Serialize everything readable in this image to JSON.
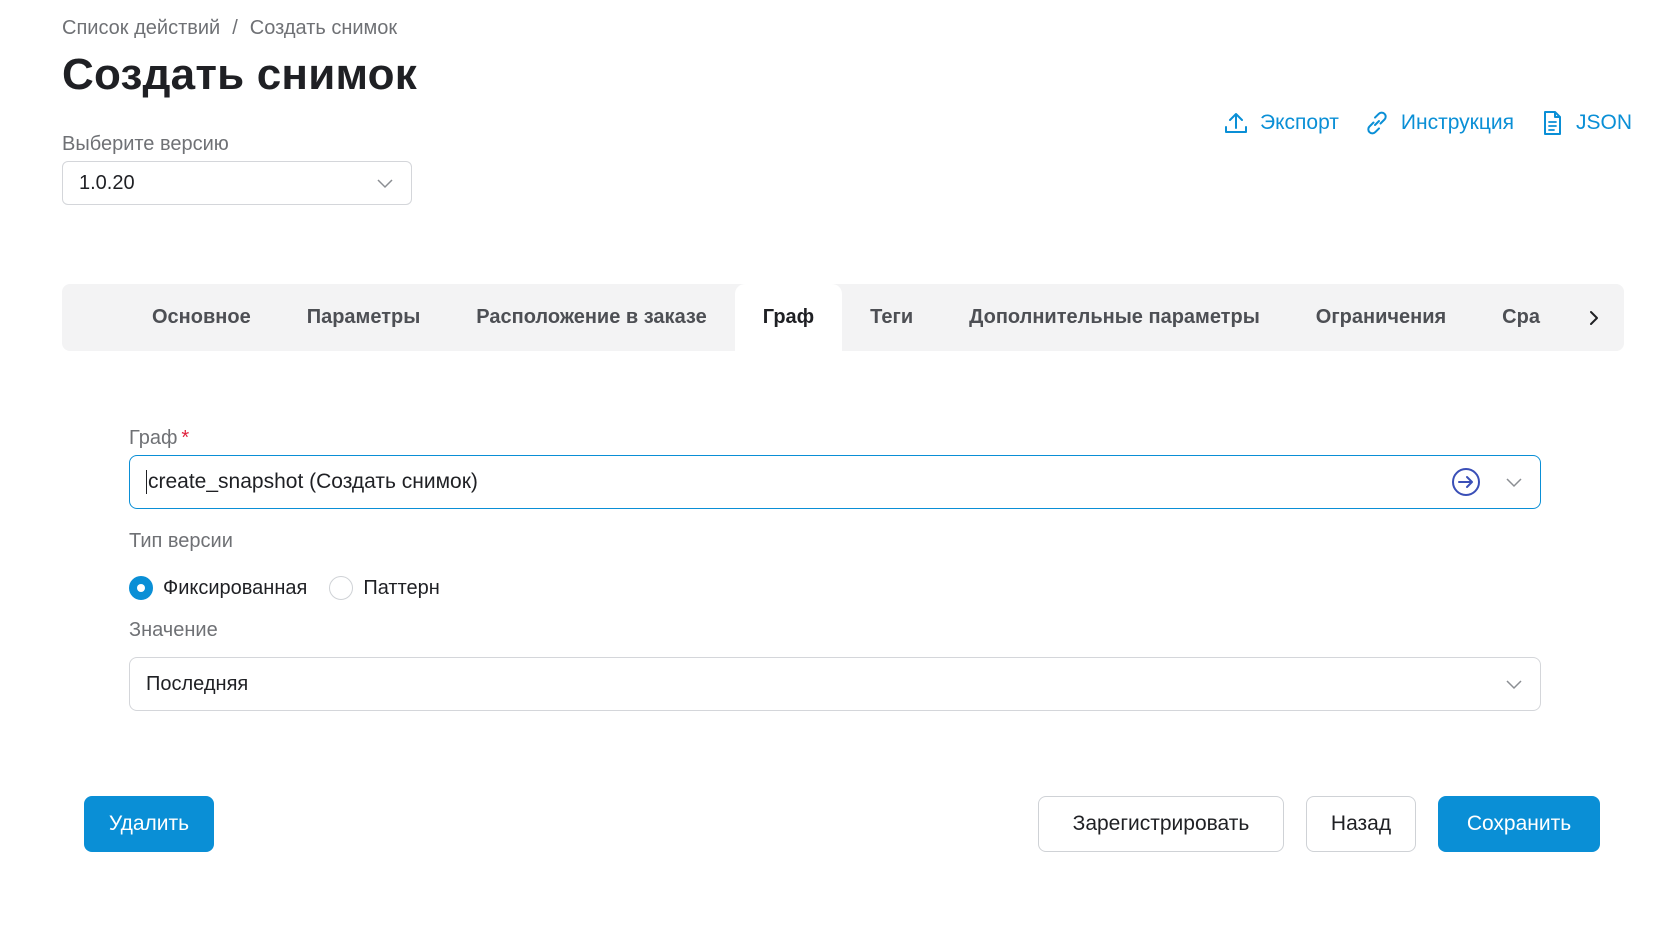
{
  "breadcrumb": {
    "parent": "Список действий",
    "separator": "/",
    "current": "Создать снимок"
  },
  "page_title": "Создать снимок",
  "version": {
    "label": "Выберите версию",
    "value": "1.0.20"
  },
  "actions": {
    "export": "Экспорт",
    "instruction": "Инструкция",
    "json": "JSON"
  },
  "tabs": [
    {
      "label": "Основное",
      "active": false
    },
    {
      "label": "Параметры",
      "active": false
    },
    {
      "label": "Расположение в заказе",
      "active": false
    },
    {
      "label": "Граф",
      "active": true
    },
    {
      "label": "Теги",
      "active": false
    },
    {
      "label": "Дополнительные параметры",
      "active": false
    },
    {
      "label": "Ограничения",
      "active": false
    },
    {
      "label": "Сра",
      "active": false
    }
  ],
  "form": {
    "graph_label": "Граф",
    "graph_required_mark": "*",
    "graph_value": "create_snapshot (Создать снимок)",
    "version_type_label": "Тип версии",
    "version_type_options": [
      {
        "label": "Фиксированная",
        "selected": true
      },
      {
        "label": "Паттерн",
        "selected": false
      }
    ],
    "value_label": "Значение",
    "value_value": "Последняя"
  },
  "buttons": {
    "delete": "Удалить",
    "register": "Зарегистрировать",
    "back": "Назад",
    "save": "Сохранить"
  },
  "colors": {
    "accent": "#0a8fd6",
    "required": "#e0223d",
    "tab_bar": "#f3f3f4"
  },
  "icons": [
    "upload-icon",
    "link-icon",
    "file-icon",
    "chevron-down-icon",
    "arrow-right-circle-icon",
    "chevron-right-icon"
  ]
}
